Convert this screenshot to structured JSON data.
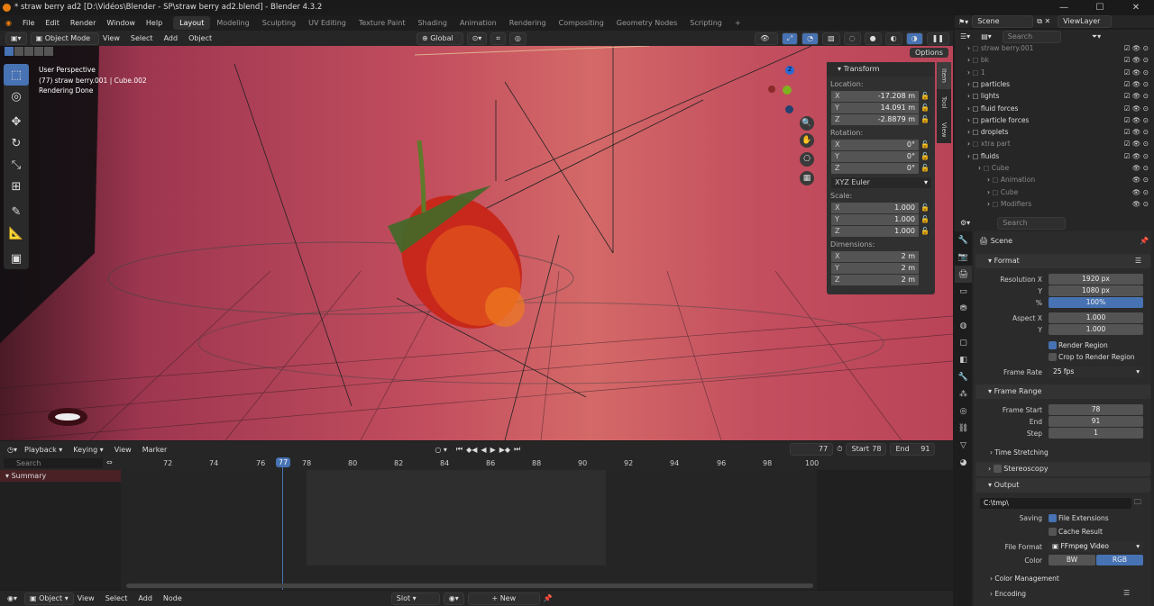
{
  "window": {
    "title": "* straw berry ad2 [D:\\Vidéos\\Blender - SP\\straw berry ad2.blend] - Blender 4.3.2"
  },
  "menu": [
    "File",
    "Edit",
    "Render",
    "Window",
    "Help"
  ],
  "workspaces": [
    "Layout",
    "Modeling",
    "Sculpting",
    "UV Editing",
    "Texture Paint",
    "Shading",
    "Animation",
    "Rendering",
    "Compositing",
    "Geometry Nodes",
    "Scripting"
  ],
  "active_workspace": "Layout",
  "top_right": {
    "scene": "Scene",
    "view_layer": "ViewLayer"
  },
  "viewport_header": {
    "mode": "Object Mode",
    "view": "View",
    "select": "Select",
    "add": "Add",
    "object": "Object",
    "orientation": "Global",
    "options": "Options"
  },
  "viewport_overlay": {
    "line1": "User Perspective",
    "line2": "(77) straw berry.001 | Cube.002",
    "line3": "Rendering Done"
  },
  "gizmo": {
    "z": "Z",
    "x": "X",
    "y": "Y"
  },
  "transform": {
    "title": "Transform",
    "location_label": "Location:",
    "location": [
      {
        "axis": "X",
        "value": "-17.208 m"
      },
      {
        "axis": "Y",
        "value": "14.091 m"
      },
      {
        "axis": "Z",
        "value": "-2.8879 m"
      }
    ],
    "rotation_label": "Rotation:",
    "rotation": [
      {
        "axis": "X",
        "value": "0°"
      },
      {
        "axis": "Y",
        "value": "0°"
      },
      {
        "axis": "Z",
        "value": "0°"
      }
    ],
    "rotation_mode": "XYZ Euler",
    "scale_label": "Scale:",
    "scale": [
      {
        "axis": "X",
        "value": "1.000"
      },
      {
        "axis": "Y",
        "value": "1.000"
      },
      {
        "axis": "Z",
        "value": "1.000"
      }
    ],
    "dimensions_label": "Dimensions:",
    "dimensions": [
      {
        "axis": "X",
        "value": "2 m"
      },
      {
        "axis": "Y",
        "value": "2 m"
      },
      {
        "axis": "Z",
        "value": "2 m"
      }
    ]
  },
  "sidetabs": [
    "Item",
    "Tool",
    "View"
  ],
  "timeline": {
    "menus": [
      "Playback",
      "Keying",
      "View",
      "Marker"
    ],
    "current_frame": "77",
    "start_label": "Start",
    "start": "78",
    "end_label": "End",
    "end": "91",
    "ruler": [
      "72",
      "74",
      "76",
      "77",
      "78",
      "80",
      "82",
      "84",
      "86",
      "88",
      "90",
      "92",
      "94",
      "96",
      "98",
      "100"
    ],
    "search_placeholder": "Search",
    "summary": "Summary"
  },
  "footer": {
    "object_menu": "Object",
    "view": "View",
    "select": "Select",
    "add": "Add",
    "node": "Node",
    "slot": "Slot",
    "new": "New"
  },
  "outliner": {
    "search_placeholder": "Search",
    "rows": [
      {
        "name": "straw berry.001",
        "dim": true
      },
      {
        "name": "bk",
        "dim": true
      },
      {
        "name": "1",
        "dim": true
      },
      {
        "name": "particles",
        "dim": false
      },
      {
        "name": "lights",
        "dim": false
      },
      {
        "name": "fluid forces",
        "dim": false
      },
      {
        "name": "particle forces",
        "dim": false
      },
      {
        "name": "droplets",
        "dim": false
      },
      {
        "name": "xtra part",
        "dim": true
      },
      {
        "name": "fluids",
        "dim": false
      },
      {
        "name": "Cube",
        "dim": true
      },
      {
        "name": "Animation",
        "dim": true
      },
      {
        "name": "Cube",
        "dim": true
      },
      {
        "name": "Modifiers",
        "dim": true
      }
    ]
  },
  "properties": {
    "search_placeholder": "Search",
    "context": "Scene",
    "format": {
      "title": "Format",
      "res_x_label": "Resolution X",
      "res_x": "1920 px",
      "res_y_label": "Y",
      "res_y": "1080 px",
      "pct_label": "%",
      "pct": "100%",
      "aspect_x_label": "Aspect X",
      "aspect_x": "1.000",
      "aspect_y_label": "Y",
      "aspect_y": "1.000",
      "render_region": "Render Region",
      "crop": "Crop to Render Region",
      "frame_rate_label": "Frame Rate",
      "frame_rate": "25 fps"
    },
    "frame_range": {
      "title": "Frame Range",
      "start_label": "Frame Start",
      "start": "78",
      "end_label": "End",
      "end": "91",
      "step_label": "Step",
      "step": "1"
    },
    "time_stretching": "Time Stretching",
    "stereoscopy": "Stereoscopy",
    "output": {
      "title": "Output",
      "path": "C:\\tmp\\",
      "saving_label": "Saving",
      "file_ext": "File Extensions",
      "cache": "Cache Result",
      "file_format_label": "File Format",
      "file_format": "FFmpeg Video",
      "color_label": "Color",
      "bw": "BW",
      "rgb": "RGB"
    },
    "color_management": "Color Management",
    "encoding": "Encoding"
  }
}
